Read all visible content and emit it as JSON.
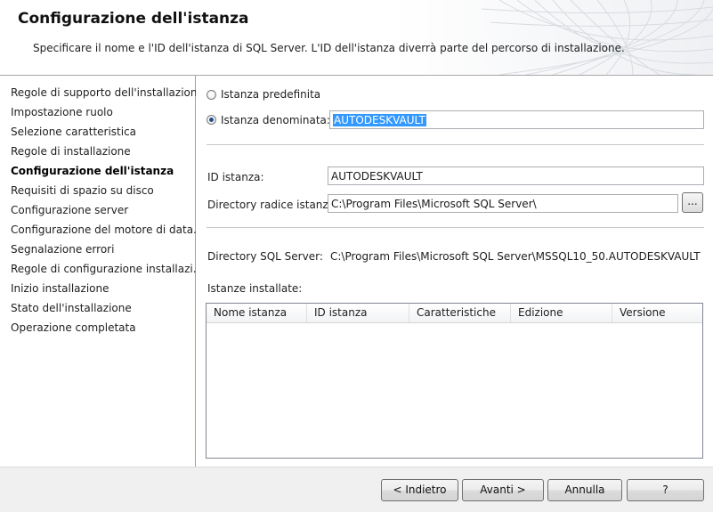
{
  "header": {
    "title": "Configurazione dell'istanza",
    "subtitle": "Specificare il nome e l'ID dell'istanza di SQL Server. L'ID dell'istanza diverrà parte del percorso di installazione."
  },
  "nav": {
    "items": [
      "Regole di supporto dell'installazione",
      "Impostazione ruolo",
      "Selezione caratteristica",
      "Regole di installazione",
      "Configurazione dell'istanza",
      "Requisiti di spazio su disco",
      "Configurazione server",
      "Configurazione del motore di data...",
      "Segnalazione errori",
      "Regole di configurazione installazi...",
      "Inizio installazione",
      "Stato dell'installazione",
      "Operazione completata"
    ],
    "active": "Configurazione dell'istanza"
  },
  "instance": {
    "default_label": "Istanza predefinita",
    "named_label": "Istanza denominata:",
    "named_value": "AUTODESKVAULT",
    "selected": "named"
  },
  "fields": {
    "instance_id_label": "ID istanza:",
    "instance_id_value": "AUTODESKVAULT",
    "root_dir_label": "Directory radice istanza:",
    "root_dir_value": "C:\\Program Files\\Microsoft SQL Server\\",
    "browse_label": "...",
    "sql_dir_label": "Directory SQL Server:",
    "sql_dir_value": "C:\\Program Files\\Microsoft SQL Server\\MSSQL10_50.AUTODESKVAULT"
  },
  "installed": {
    "label": "Istanze installate:",
    "columns": [
      "Nome istanza",
      "ID istanza",
      "Caratteristiche",
      "Edizione",
      "Versione"
    ],
    "rows": []
  },
  "footer": {
    "back": "< Indietro",
    "next": "Avanti >",
    "cancel": "Annulla",
    "help": "?"
  },
  "colors": {
    "selection": "#3399ff",
    "radio_dot": "#1f4e8a"
  }
}
